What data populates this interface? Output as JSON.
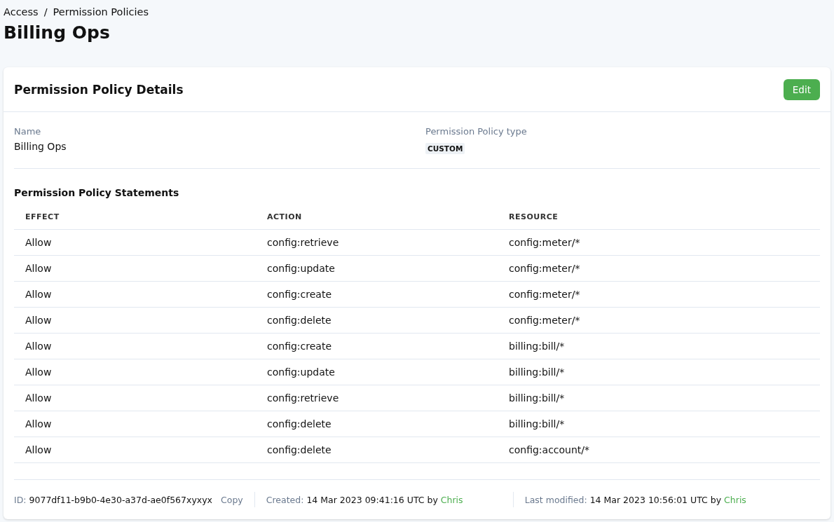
{
  "breadcrumb": [
    {
      "label": "Access"
    },
    {
      "label": "Permission Policies"
    }
  ],
  "breadcrumb_separator": "/",
  "page_title": "Billing Ops",
  "card": {
    "title": "Permission Policy Details",
    "edit_button": "Edit",
    "fields": [
      {
        "label": "Name",
        "value": "Billing Ops",
        "kind": "text"
      },
      {
        "label": "Permission Policy type",
        "value": "CUSTOM",
        "kind": "tag"
      }
    ],
    "statements": {
      "title": "Permission Policy Statements",
      "columns": [
        "EFFECT",
        "ACTION",
        "RESOURCE"
      ],
      "rows": [
        [
          "Allow",
          "config:retrieve",
          "config:meter/*"
        ],
        [
          "Allow",
          "config:update",
          "config:meter/*"
        ],
        [
          "Allow",
          "config:create",
          "config:meter/*"
        ],
        [
          "Allow",
          "config:delete",
          "config:meter/*"
        ],
        [
          "Allow",
          "config:create",
          "billing:bill/*"
        ],
        [
          "Allow",
          "config:update",
          "billing:bill/*"
        ],
        [
          "Allow",
          "config:retrieve",
          "billing:bill/*"
        ],
        [
          "Allow",
          "config:delete",
          "billing:bill/*"
        ],
        [
          "Allow",
          "config:delete",
          "config:account/*"
        ]
      ]
    },
    "footer": {
      "id_label": "ID:",
      "id_value": "9077df11-b9b0-4e30-a37d-ae0f567xyxyx",
      "copy_link": "Copy",
      "created_label": "Created:",
      "created_value": "14 Mar 2023 09:41:16 UTC by",
      "created_by": "Chris",
      "modified_label": "Last modified:",
      "modified_value": "14 Mar 2023 10:56:01 UTC by",
      "modified_by": "Chris"
    }
  }
}
